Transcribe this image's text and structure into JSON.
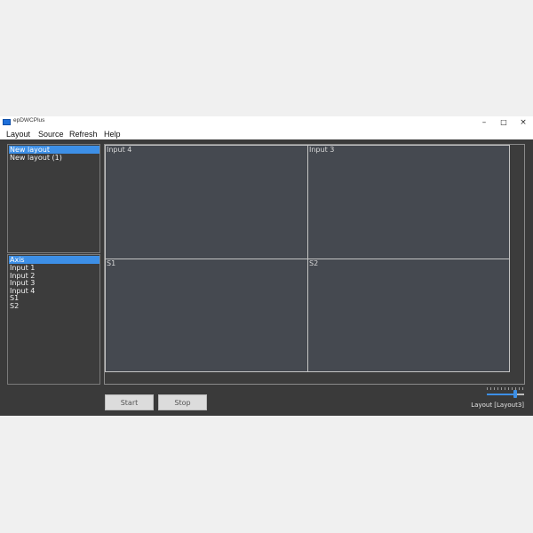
{
  "window": {
    "title": "epDWCPlus"
  },
  "menu": [
    "Layout",
    "Source",
    "Refresh",
    "Help"
  ],
  "layouts_list": [
    {
      "label": "New layout",
      "selected": true
    },
    {
      "label": "New layout (1)",
      "selected": false
    }
  ],
  "sources_list": [
    {
      "label": "Axis",
      "selected": true
    },
    {
      "label": "Input 1",
      "selected": false
    },
    {
      "label": "Input 2",
      "selected": false
    },
    {
      "label": "Input 3",
      "selected": false
    },
    {
      "label": "Input 4",
      "selected": false
    },
    {
      "label": "S1",
      "selected": false
    },
    {
      "label": "S2",
      "selected": false
    }
  ],
  "grid_cells": [
    {
      "label": "Input 4"
    },
    {
      "label": "Input 3"
    },
    {
      "label": "S1"
    },
    {
      "label": "S2"
    }
  ],
  "buttons": {
    "start": "Start",
    "stop": "Stop"
  },
  "zoom": {
    "level": 0.8
  },
  "status": "Layout [Layout3]",
  "colors": {
    "accent": "#3d8fe6",
    "background": "#3a3a3a",
    "cell": "#454950"
  }
}
